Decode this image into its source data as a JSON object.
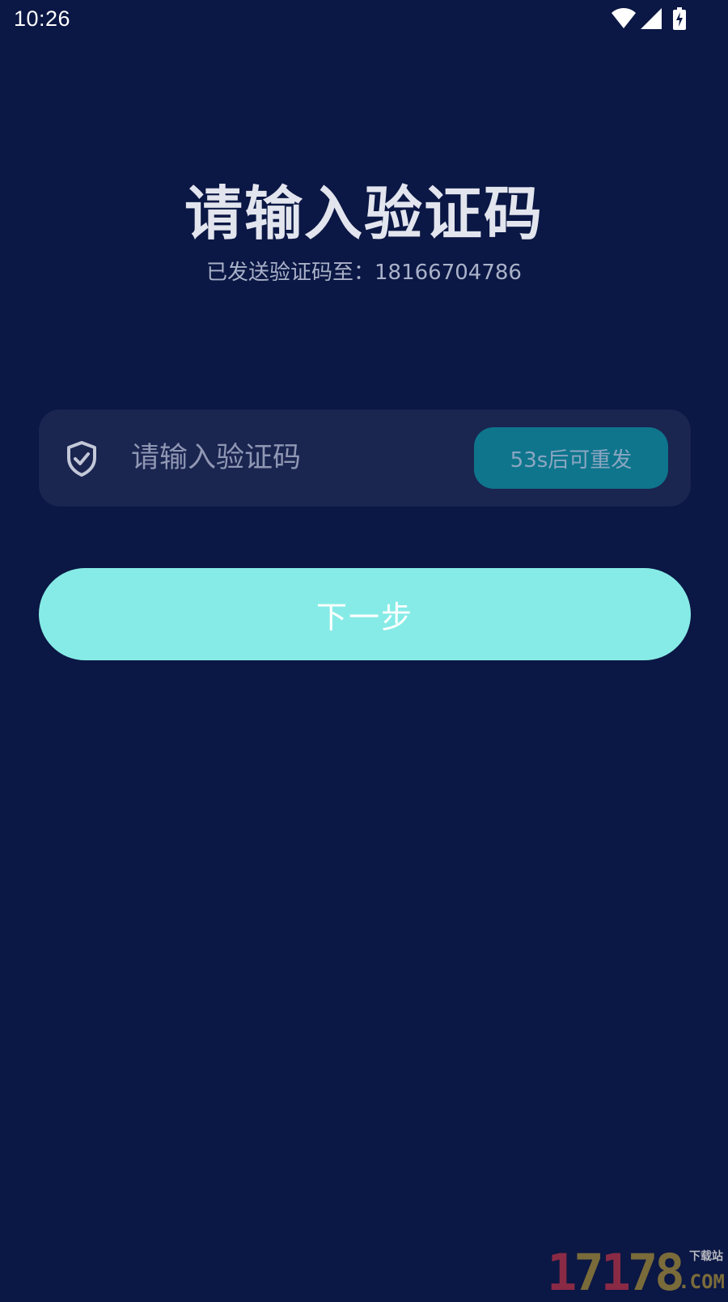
{
  "status_bar": {
    "time": "10:26",
    "icons": [
      "wifi-icon",
      "signal-icon",
      "battery-charging-icon"
    ]
  },
  "title": "请输入验证码",
  "subtitle": "已发送验证码至：18166704786",
  "code_input": {
    "placeholder": "请输入验证码",
    "value": "",
    "icon": "shield-check-icon"
  },
  "resend_button": {
    "label": "53s后可重发"
  },
  "next_button": {
    "label": "下一步"
  },
  "watermark": {
    "digits": "17178",
    "tag": "下载站",
    "domain": ".COM"
  },
  "colors": {
    "background": "#0b1744",
    "input_background": "#1a2550",
    "resend_background": "#0e758c",
    "next_background": "#86ebe6"
  }
}
